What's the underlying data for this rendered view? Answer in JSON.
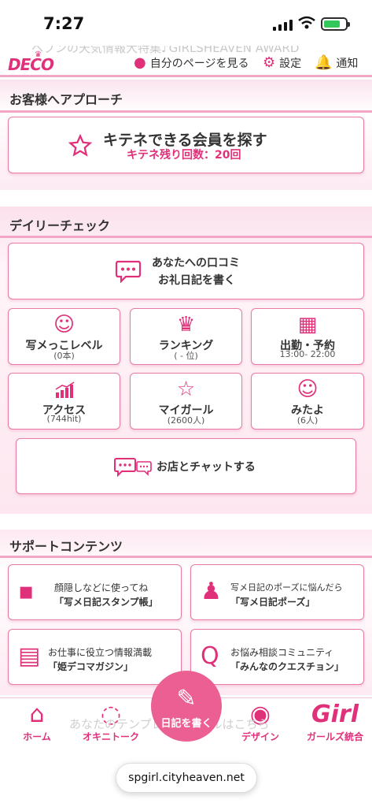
{
  "status": {
    "time": "7:27"
  },
  "header": {
    "ticker": "ヘブンの天気情報大特集♪GIRLSHEAVEN AWARD",
    "logo": "DECO",
    "my_page": "自分のページを見る",
    "settings": "設定",
    "notifications": "通知"
  },
  "approach": {
    "title": "お客様へアプローチ",
    "search_label": "キテネできる会員を探す",
    "remaining": "キテネ残り回数：20回"
  },
  "daily": {
    "title": "デイリーチェック",
    "review_line1": "あなたへの口コミ",
    "review_line2": "お礼日記を書く",
    "tiles": [
      {
        "label": "写メっこレベル",
        "sub": "(0本)",
        "icon": "angel-icon"
      },
      {
        "label": "ランキング",
        "sub": "( - 位)",
        "icon": "crown-icon"
      },
      {
        "label": "出勤・予約",
        "sub": "13:00- 22:00",
        "icon": "calendar-icon"
      },
      {
        "label": "アクセス",
        "sub": "(744hit)",
        "icon": "bar-chart-icon"
      },
      {
        "label": "マイガール",
        "sub": "(2600人)",
        "icon": "star-icon"
      },
      {
        "label": "みたよ",
        "sub": "(6人)",
        "icon": "smile-icon"
      }
    ],
    "chat_label": "お店とチャットする"
  },
  "support": {
    "title": "サポートコンテンツ",
    "items": [
      {
        "line1": "顔隠しなどに使ってね",
        "line2": "「写メ日記スタンプ帳」",
        "icon": "stamp-icon"
      },
      {
        "line1": "写メ日記のポーズに悩んだら",
        "line2": "「写メ日記ポーズ」",
        "icon": "pose-icon"
      },
      {
        "line1": "お仕事に役立つ情報満載",
        "line2": "「姫デコマガジン」",
        "icon": "magazine-icon"
      },
      {
        "line1": "お悩み相談コミュニティ",
        "line2": "「みんなのクエスチョン」",
        "icon": "question-icon"
      }
    ]
  },
  "ghost_text": "あなたのテンプレートレベルはこちら",
  "bottom_nav": {
    "home": "ホーム",
    "talk": "オキニトーク",
    "diary": "日記を書く",
    "design": "デザイン",
    "girls": "ガールズ統合"
  },
  "url": "spgirl.cityheaven.net"
}
